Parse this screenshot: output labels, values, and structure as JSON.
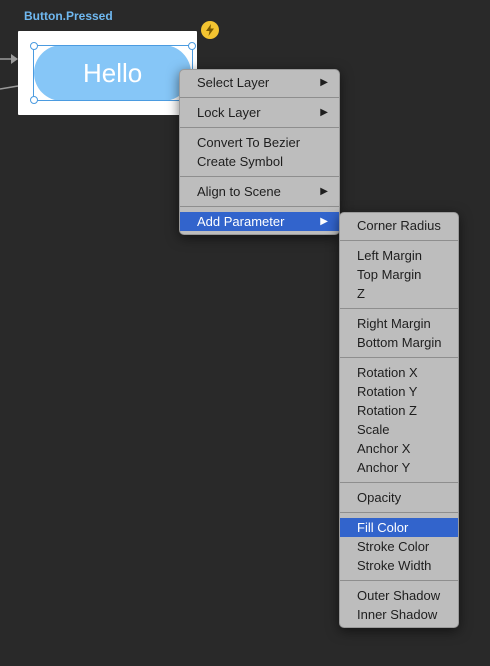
{
  "canvas": {
    "state_title": "Button.Pressed",
    "button_text": "Hello",
    "badge_icon": "lightning-icon"
  },
  "context_menu": {
    "groups": [
      [
        {
          "label": "Select Layer",
          "submenu": true
        }
      ],
      [
        {
          "label": "Lock Layer",
          "submenu": true
        }
      ],
      [
        {
          "label": "Convert To Bezier",
          "submenu": false
        },
        {
          "label": "Create Symbol",
          "submenu": false
        }
      ],
      [
        {
          "label": "Align to Scene",
          "submenu": true
        }
      ],
      [
        {
          "label": "Add Parameter",
          "submenu": true,
          "highlighted": true
        }
      ]
    ],
    "arrow_glyph": "▶"
  },
  "parameter_submenu": {
    "groups": [
      [
        {
          "label": "Corner Radius"
        }
      ],
      [
        {
          "label": "Left Margin"
        },
        {
          "label": "Top Margin"
        },
        {
          "label": "Z"
        }
      ],
      [
        {
          "label": "Right Margin"
        },
        {
          "label": "Bottom Margin"
        }
      ],
      [
        {
          "label": "Rotation X"
        },
        {
          "label": "Rotation Y"
        },
        {
          "label": "Rotation Z"
        },
        {
          "label": "Scale"
        },
        {
          "label": "Anchor X"
        },
        {
          "label": "Anchor Y"
        }
      ],
      [
        {
          "label": "Opacity"
        }
      ],
      [
        {
          "label": "Fill Color",
          "highlighted": true
        },
        {
          "label": "Stroke Color"
        },
        {
          "label": "Stroke Width"
        }
      ],
      [
        {
          "label": "Outer Shadow"
        },
        {
          "label": "Inner Shadow"
        }
      ]
    ]
  },
  "colors": {
    "background": "#292929",
    "accent_blue": "#6fb8f0",
    "button_fill": "#86c6f7",
    "menu_bg": "#bdbdbd",
    "highlight": "#3264cc",
    "badge": "#f3c431"
  }
}
